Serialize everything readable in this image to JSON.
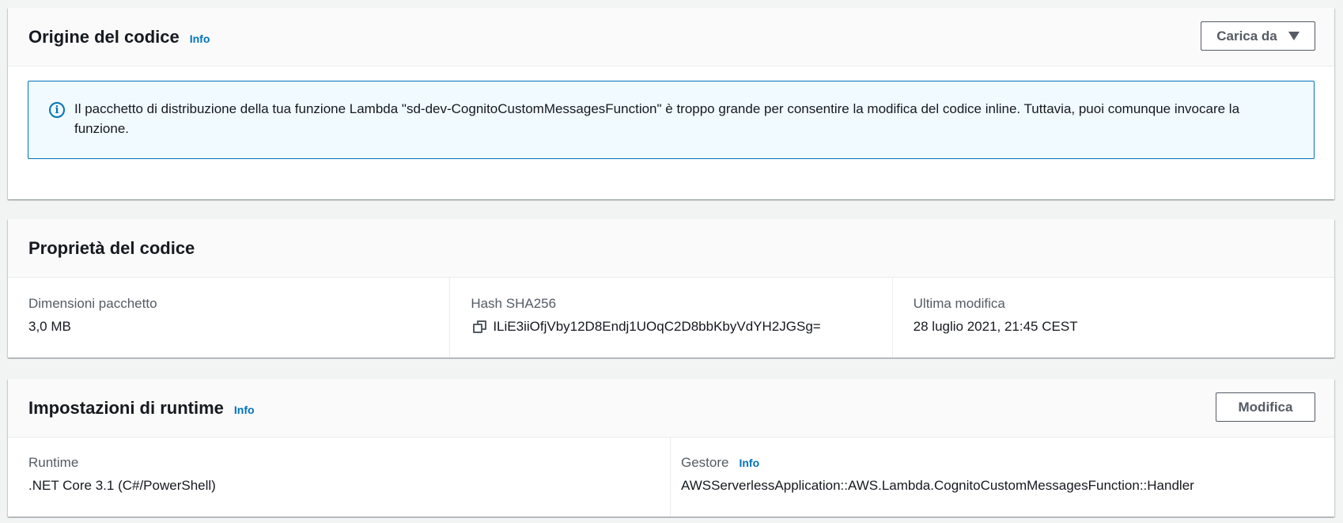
{
  "code_source": {
    "title": "Origine del codice",
    "info_label": "Info",
    "upload_button_label": "Carica da",
    "alert_text": "Il pacchetto di distribuzione della tua funzione Lambda \"sd-dev-CognitoCustomMessagesFunction\" è troppo grande per consentire la modifica del codice inline. Tuttavia, puoi comunque invocare la funzione.",
    "alert_icon": "info-circle-icon"
  },
  "code_properties": {
    "title": "Proprietà del codice",
    "package_size_label": "Dimensioni pacchetto",
    "package_size_value": "3,0 MB",
    "hash_label": "Hash SHA256",
    "hash_value": "ILiE3iiOfjVby12D8Endj1UOqC2D8bbKbyVdYH2JGSg=",
    "copy_icon": "copy-icon",
    "last_modified_label": "Ultima modifica",
    "last_modified_value": "28 luglio 2021, 21:45 CEST"
  },
  "runtime_settings": {
    "title": "Impostazioni di runtime",
    "info_label": "Info",
    "edit_button_label": "Modifica",
    "runtime_label": "Runtime",
    "runtime_value": ".NET Core 3.1 (C#/PowerShell)",
    "handler_label": "Gestore",
    "handler_info_label": "Info",
    "handler_value": "AWSServerlessApplication::AWS.Lambda.CognitoCustomMessagesFunction::Handler"
  },
  "colors": {
    "link": "#0073bb",
    "alert_bg": "#f1faff",
    "page_bg": "#f2f3f3"
  }
}
